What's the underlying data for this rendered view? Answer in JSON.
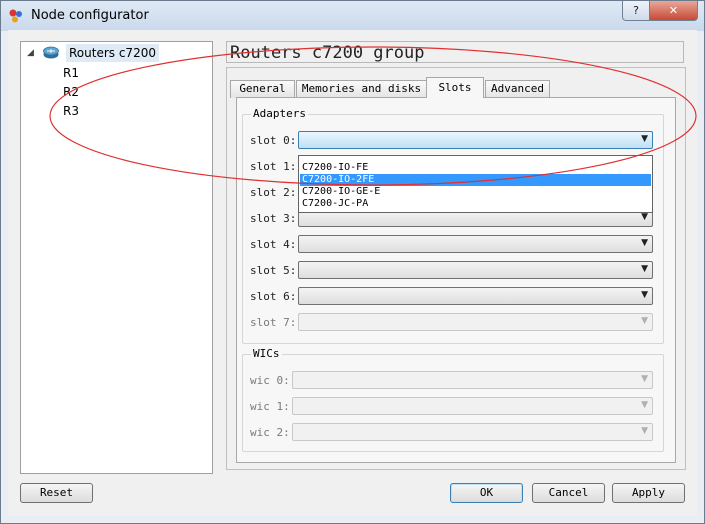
{
  "window": {
    "title": "Node configurator",
    "help_glyph": "?",
    "close_glyph": "✕"
  },
  "tree": {
    "root_label": "Routers c7200",
    "children": [
      "R1",
      "R2",
      "R3"
    ]
  },
  "group_title": "Routers c7200 group",
  "tabs": [
    "General",
    "Memories and disks",
    "Slots",
    "Advanced"
  ],
  "active_tab": "Slots",
  "adapters": {
    "title": "Adapters",
    "slots": [
      "slot 0:",
      "slot 1:",
      "slot 2:",
      "slot 3:",
      "slot 4:",
      "slot 5:",
      "slot 6:",
      "slot 7:"
    ],
    "dropdown_options": [
      "C7200-IO-FE",
      "C7200-IO-2FE",
      "C7200-IO-GE-E",
      "C7200-JC-PA"
    ],
    "highlighted_option": "C7200-IO-2FE"
  },
  "wics": {
    "title": "WICs",
    "slots": [
      "wic 0:",
      "wic 1:",
      "wic 2:"
    ]
  },
  "buttons": {
    "reset": "Reset",
    "ok": "OK",
    "cancel": "Cancel",
    "apply": "Apply"
  },
  "colors": {
    "selection": "#3399ff",
    "annotation": "#e03030"
  },
  "icons": {
    "router": "router-icon",
    "dropdown_arrow": "chevron-down-icon"
  }
}
